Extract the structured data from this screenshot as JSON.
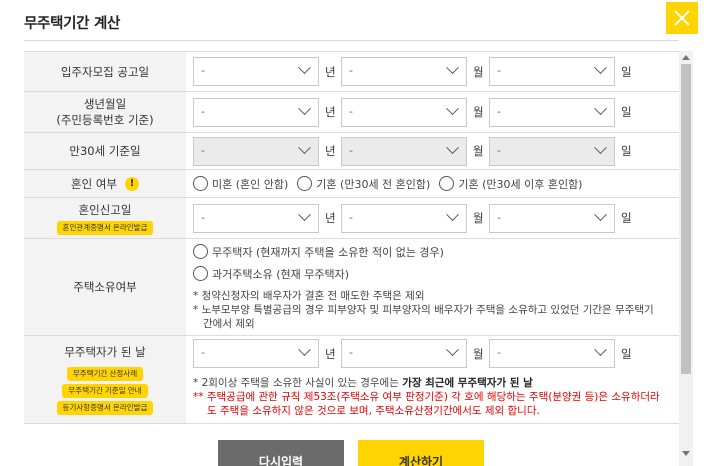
{
  "modal": {
    "title": "무주택기간 계산"
  },
  "placeholder": "-",
  "units": {
    "year": "년",
    "month": "월",
    "day": "일"
  },
  "rows": {
    "notice_date": {
      "label": "입주자모집 공고일"
    },
    "birth_date": {
      "label": "생년월일",
      "sublabel": "(주민등록번호 기준)"
    },
    "age30_date": {
      "label": "만30세 기준일"
    },
    "marriage": {
      "label": "혼인 여부",
      "warn_icon": "!",
      "options": [
        "미혼 (혼인 안함)",
        "기혼 (만30세 전 혼인함)",
        "기혼 (만30세 이후 혼인함)"
      ]
    },
    "marriage_report": {
      "label": "혼인신고일",
      "button": "혼인관계증명서 온라인발급"
    },
    "ownership": {
      "label": "주택소유여부",
      "options": [
        "무주택자 (현재까지 주택을 소유한 적이 없는 경우)",
        "과거주택소유 (현재 무주택자)"
      ],
      "notes": [
        "* 청약신청자의 배우자가 결혼 전 매도한 주택은 제외",
        "* 노부모부양 특별공급의 경우 피부양자 및 피부양자의 배우자가 주택을 소유하고 있었던 기간은 무주택기",
        "간에서 제외"
      ]
    },
    "homeless_date": {
      "label": "무주택자가 된 날",
      "buttons": [
        "무주택기간 산정사례",
        "무주택기간 기준일 안내",
        "등기사항증명서 온라인발급"
      ],
      "note1_prefix": "* 2회이상 주택을 소유한 사실이 있는 경우에는 ",
      "note1_bold": "가장 최근에 무주택자가 된 날",
      "note2_line1": "** 주택공급에 관한 규칙 제53조(주택소유 여부 판정기준) 각 호에 해당하는 주택(분양권 등)은 소유하더라",
      "note2_line2": "도 주택을 소유하지 않은 것으로 보며, 주택소유산정기간에서도 제외 합니다."
    }
  },
  "actions": {
    "reset": "다시입력",
    "calculate": "계산하기"
  },
  "colors": {
    "accent": "#ffd400",
    "note_red": "#e60000",
    "reset_bg": "#6b6b6b"
  }
}
